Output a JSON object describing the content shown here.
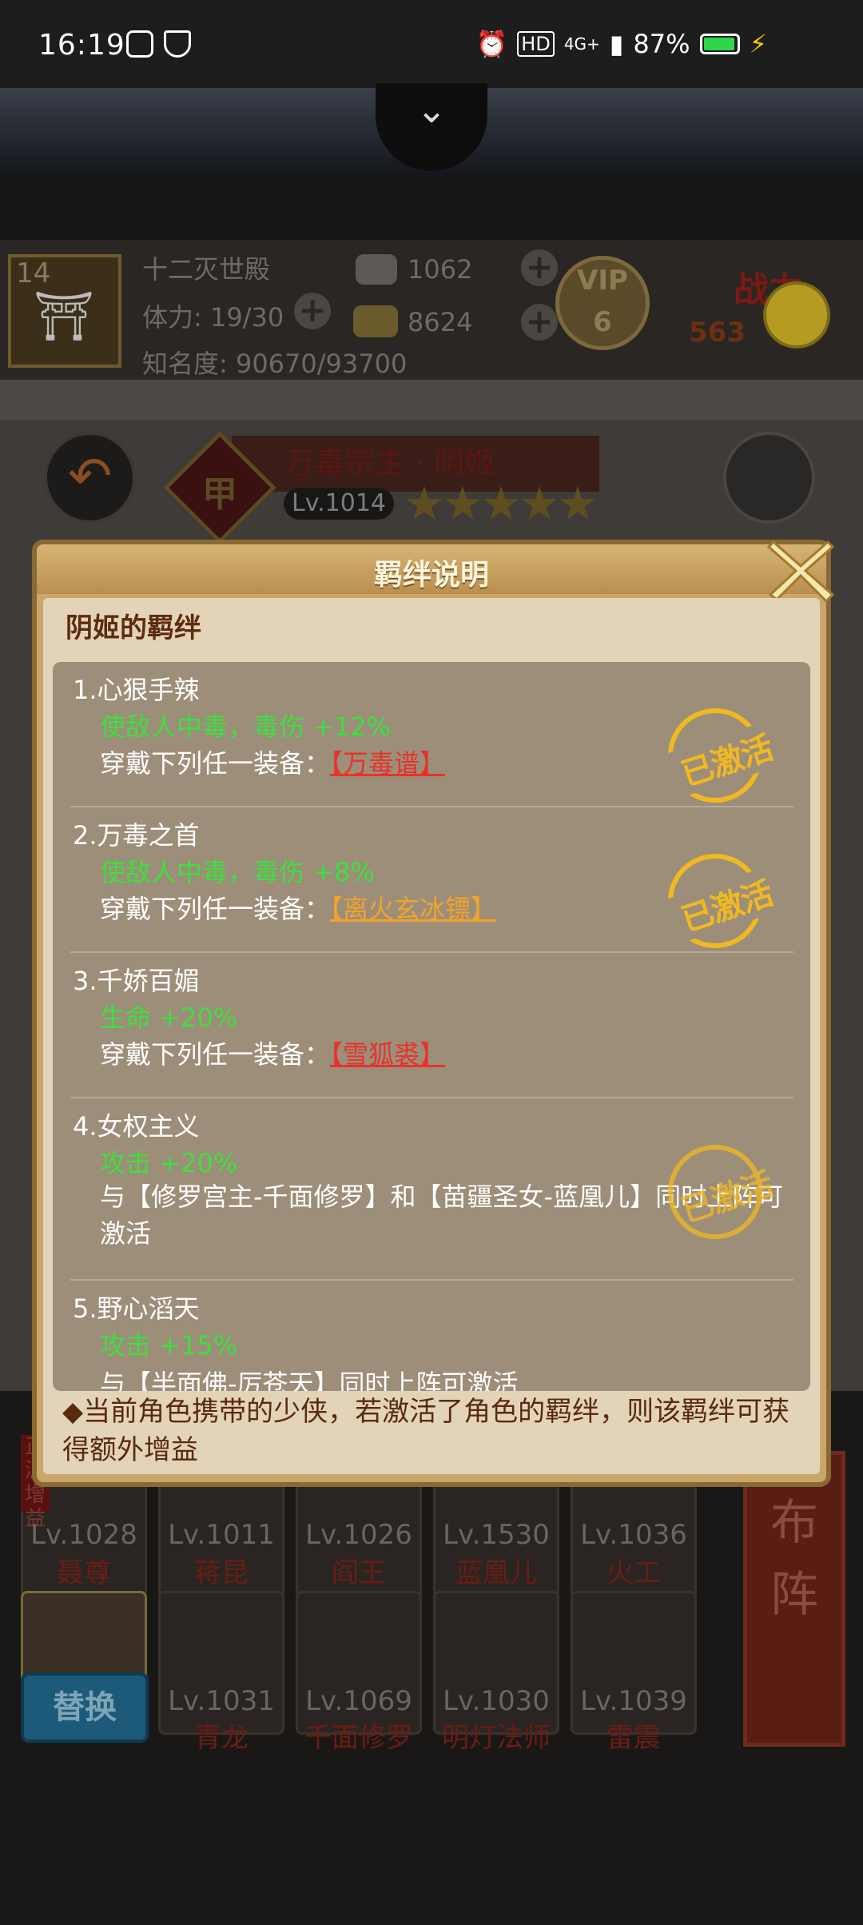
{
  "status_bar": {
    "time": "16:19",
    "battery": "87%",
    "network": "4G+"
  },
  "player": {
    "level": "14",
    "location": "十二灭世殿",
    "stamina": "体力: 19/30",
    "fame": "知名度: 90670/93700",
    "silver": "1062",
    "gold": "8624",
    "vip_label": "VIP",
    "vip_level": "6",
    "power_label": "战力",
    "power_value": "563"
  },
  "character": {
    "title": "万毒宗主 · 阴姬",
    "badge": "甲",
    "level": "Lv.1014",
    "stars": "★★★★★"
  },
  "dialog": {
    "title": "羁绊说明",
    "heading": "阴姬的羁绊",
    "stamp_text": "已激活",
    "entries": [
      {
        "title": "1.心狠手辣",
        "effect": "使敌人中毒，毒伤 +12%",
        "desc": "穿戴下列任一装备：",
        "equip": "【万毒谱】"
      },
      {
        "title": "2.万毒之首",
        "effect": "使敌人中毒，毒伤 +8%",
        "desc": "穿戴下列任一装备：",
        "equip": "【离火玄冰镖】"
      },
      {
        "title": "3.千娇百媚",
        "effect": "生命 +20%",
        "desc": "穿戴下列任一装备：",
        "equip": "【雪狐裘】"
      },
      {
        "title": "4.女权主义",
        "effect": "攻击 +20%",
        "desc": "与【修罗宫主-千面修罗】和【苗疆圣女-蓝凰儿】同时上阵可激活"
      },
      {
        "title": "5.野心滔天",
        "effect": "攻击 +15%",
        "desc": "与【半面佛-厉苍天】同时上阵可激活"
      }
    ],
    "footer": "◆当前角色携带的少侠，若激活了角色的羁绊，则该羁绊可获得额外增益"
  },
  "heroes_row1": [
    {
      "level": "Lv.1028",
      "name": "聂尊"
    },
    {
      "level": "Lv.1011",
      "name": "蒋昆"
    },
    {
      "level": "Lv.1026",
      "name": "阎王"
    },
    {
      "level": "Lv.1530",
      "name": "蓝凰儿"
    },
    {
      "level": "Lv.1036",
      "name": "火工"
    }
  ],
  "heroes_row2": [
    {
      "level": "Lv.1031",
      "name": "青龙"
    },
    {
      "level": "Lv.1069",
      "name": "千面修罗"
    },
    {
      "level": "Lv.1030",
      "name": "明灯法师"
    },
    {
      "level": "Lv.1039",
      "name": "雷震"
    }
  ],
  "buttons": {
    "replace": "替换",
    "formation": "布阵",
    "tag_text": "正派增益"
  },
  "colors": {
    "effect_green": "#3ee03e",
    "equip_red": "#e8322a",
    "equip_orange": "#f2a32a",
    "stamp_gold": "#f1b920"
  }
}
